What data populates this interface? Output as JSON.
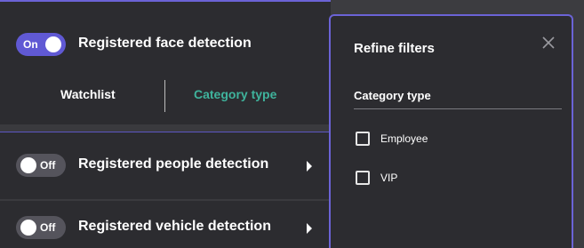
{
  "face_detection": {
    "toggle_state": "On",
    "title": "Registered face detection",
    "tabs": [
      {
        "label": "Watchlist",
        "active": true
      },
      {
        "label": "Category type",
        "active": false
      }
    ]
  },
  "people_detection": {
    "toggle_state": "Off",
    "title": "Registered people detection"
  },
  "vehicle_detection": {
    "toggle_state": "Off",
    "title": "Registered vehicle detection"
  },
  "refine_filters": {
    "title": "Refine filters",
    "section_title": "Category type",
    "options": [
      {
        "label": "Employee",
        "checked": false
      },
      {
        "label": "VIP",
        "checked": false
      }
    ]
  },
  "colors": {
    "accent": "#6b63d6",
    "toggle_on": "#6059d4",
    "toggle_off": "#55545c",
    "tab_inactive": "#3fb39c",
    "panel_bg": "#2c2c30"
  },
  "icons": {
    "close": "close-icon",
    "chevron": "chevron-right-icon"
  }
}
